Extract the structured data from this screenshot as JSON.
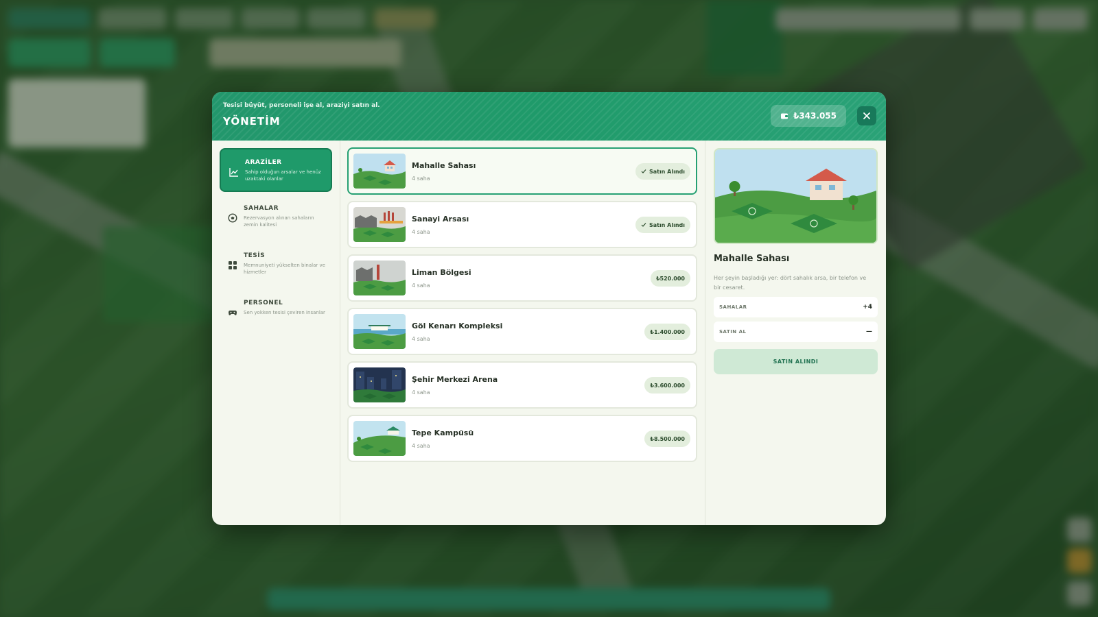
{
  "header": {
    "subtitle": "Tesisi büyüt, personeli işe al, araziyi satın al.",
    "title": "YÖNETİM",
    "balance": "₺343.055",
    "balance_icon": "wallet-icon",
    "close_icon": "close-icon"
  },
  "sidebar": {
    "items": [
      {
        "title": "ARAZİLER",
        "desc": "Sahip olduğun arsalar ve henüz uzaktaki olanlar",
        "icon": "chart-icon",
        "active": true
      },
      {
        "title": "SAHALAR",
        "desc": "Rezervasyon alınan sahaların zemin kalitesi",
        "icon": "ball-icon",
        "active": false
      },
      {
        "title": "TESİS",
        "desc": "Memnuniyeti yükselten binalar ve hizmetler",
        "icon": "grid-icon",
        "active": false
      },
      {
        "title": "PERSONEL",
        "desc": "Sen yokken tesisi çeviren insanlar",
        "icon": "gamepad-icon",
        "active": false
      }
    ]
  },
  "lands": [
    {
      "name": "Mahalle Sahası",
      "sub": "4 saha",
      "badge": "Satın Alındı",
      "owned": true,
      "selected": true,
      "scene": "house"
    },
    {
      "name": "Sanayi Arsası",
      "sub": "4 saha",
      "badge": "Satın Alındı",
      "owned": true,
      "selected": false,
      "scene": "industry"
    },
    {
      "name": "Liman Bölgesi",
      "sub": "4 saha",
      "badge": "₺520.000",
      "owned": false,
      "selected": false,
      "scene": "port"
    },
    {
      "name": "Göl Kenarı Kompleksi",
      "sub": "4 saha",
      "badge": "₺1.400.000",
      "owned": false,
      "selected": false,
      "scene": "lake"
    },
    {
      "name": "Şehir Merkezi Arena",
      "sub": "4 saha",
      "badge": "₺3.600.000",
      "owned": false,
      "selected": false,
      "scene": "city"
    },
    {
      "name": "Tepe Kampüsü",
      "sub": "4 saha",
      "badge": "₺8.500.000",
      "owned": false,
      "selected": false,
      "scene": "hill"
    }
  ],
  "detail": {
    "name": "Mahalle Sahası",
    "desc": "Her şeyin başladığı yer: dört sahalık arsa, bir telefon ve bir cesaret.",
    "stats": [
      {
        "label": "SAHALAR",
        "value": "+4"
      },
      {
        "label": "SATIN AL",
        "value": "—"
      }
    ],
    "button": "SATIN ALINDI"
  },
  "colors": {
    "accent": "#1f9a6a",
    "panel": "#f4f7ee",
    "badge": "#e3eedd"
  }
}
